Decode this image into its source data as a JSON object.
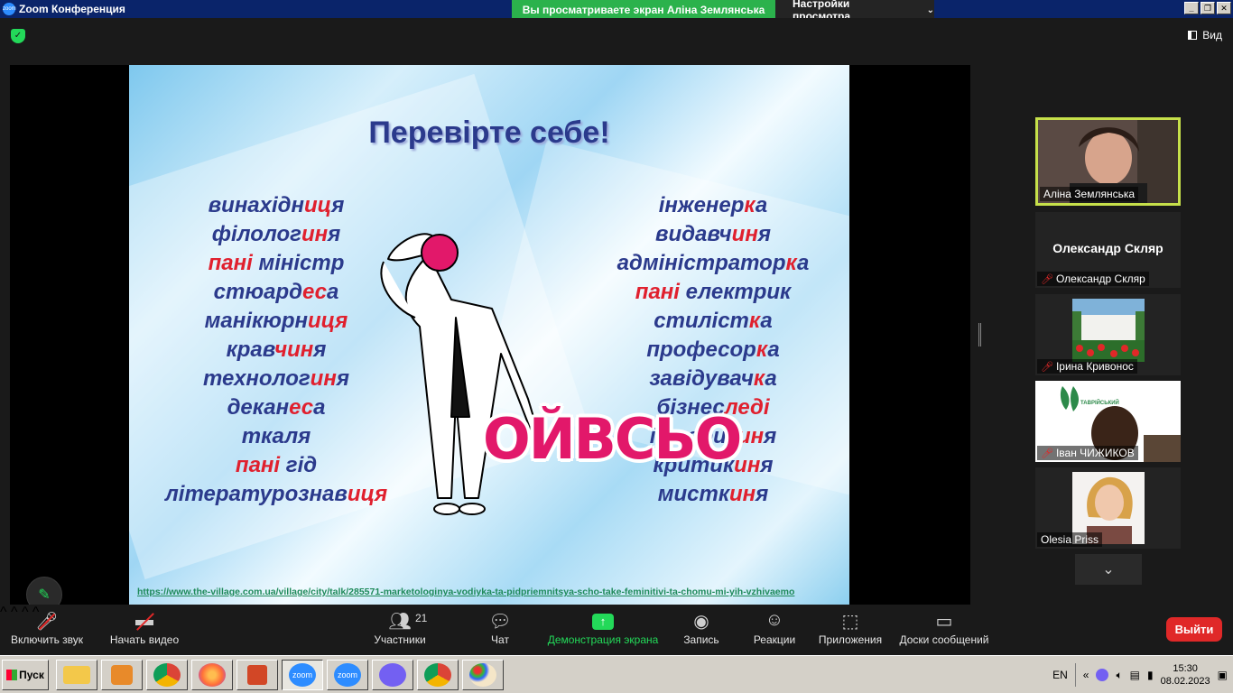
{
  "window": {
    "title": "Zoom Конференция",
    "banner": "Вы просматриваете экран Аліна Землянська",
    "view_settings": "Настройки просмотра"
  },
  "topbar": {
    "view_label": "Вид"
  },
  "slide": {
    "title": "Перевірте себе!",
    "left_words": [
      [
        "винахідн",
        "иц",
        "я"
      ],
      [
        "філолог",
        "ин",
        "я"
      ],
      [
        "",
        "пані",
        " міністр"
      ],
      [
        "стюард",
        "ес",
        "а"
      ],
      [
        "манікюрн",
        "иця",
        ""
      ],
      [
        "крав",
        "чин",
        "я"
      ],
      [
        "технолог",
        "ин",
        "я"
      ],
      [
        "декан",
        "ес",
        "а"
      ],
      [
        "ткаля",
        "",
        ""
      ],
      [
        "",
        "пані",
        " гід"
      ],
      [
        "літературознав",
        "иця",
        ""
      ]
    ],
    "right_words": [
      [
        "інженер",
        "к",
        "а"
      ],
      [
        "видавч",
        "ин",
        "я"
      ],
      [
        "адміністратор",
        "к",
        "а"
      ],
      [
        "",
        "пані",
        " електрик"
      ],
      [
        "стиліст",
        "к",
        "а"
      ],
      [
        "професор",
        "к",
        "а"
      ],
      [
        "завідувач",
        "к",
        "а"
      ],
      [
        "бізнес",
        "леді",
        ""
      ],
      [
        "історик",
        "ин",
        "я"
      ],
      [
        "критик",
        "ин",
        "я"
      ],
      [
        "мистк",
        "ин",
        "я"
      ]
    ],
    "sticker": "ОЙВСЬО",
    "link": "https://www.the-village.com.ua/village/city/talk/285571-marketologinya-vodiyka-ta-pidpriemnitsya-scho-take-feminitivi-ta-chomu-mi-yih-vzhivaemo"
  },
  "participants": {
    "tiles": [
      {
        "name": "Аліна Землянська",
        "muted": false,
        "active": true
      },
      {
        "name": "Олександр Скляр",
        "display_name": "Олександр Скляр",
        "muted": true
      },
      {
        "name": "Ірина Кривонос",
        "muted": true
      },
      {
        "name": "Іван ЧИЖИКОВ",
        "muted": true
      },
      {
        "name": "Olesia Priss",
        "muted": false
      }
    ],
    "partial_logo_text": "ТАВРІЙСЬКИЙ"
  },
  "toolbar": {
    "unmute": "Включить звук",
    "start_video": "Начать видео",
    "participants": "Участники",
    "participants_count": "21",
    "chat": "Чат",
    "share": "Демонстрация экрана",
    "record": "Запись",
    "reactions": "Реакции",
    "apps": "Приложения",
    "whiteboards": "Доски сообщений",
    "leave": "Выйти"
  },
  "taskbar": {
    "start": "Пуск",
    "lang": "EN",
    "time": "15:30",
    "date": "08.02.2023",
    "zoom1": "zoom",
    "zoom2": "zoom",
    "colors": {
      "chrome": "#db4437",
      "firefox": "#ff7139",
      "viber": "#7360f2",
      "zoom": "#2d8cff"
    }
  }
}
